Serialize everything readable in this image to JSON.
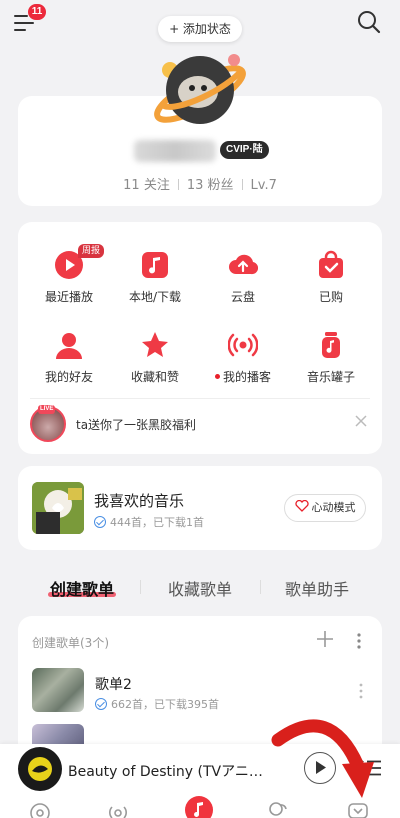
{
  "top": {
    "menu_badge": "11",
    "add_status": "+ 添加状态"
  },
  "profile": {
    "vip_badge": "CVIP·陆",
    "follows": "11 关注",
    "fans": "13 粉丝",
    "level": "Lv.7"
  },
  "grid": {
    "weekly_tag": "周报",
    "items": [
      {
        "label": "最近播放",
        "icon": "play-circle-icon"
      },
      {
        "label": "本地/下载",
        "icon": "music-note-icon"
      },
      {
        "label": "云盘",
        "icon": "cloud-upload-icon"
      },
      {
        "label": "已购",
        "icon": "shopping-bag-icon"
      },
      {
        "label": "我的好友",
        "icon": "person-icon"
      },
      {
        "label": "收藏和赞",
        "icon": "star-icon"
      },
      {
        "label": "我的播客",
        "icon": "podcast-icon"
      },
      {
        "label": "音乐罐子",
        "icon": "music-jar-icon"
      }
    ]
  },
  "gift": {
    "live_tag": "LIVE",
    "text": "ta送你了一张黑胶福利"
  },
  "liked": {
    "title": "我喜欢的音乐",
    "sub": "444首，已下载1首",
    "mode_button": "心动模式"
  },
  "tabs": [
    {
      "label": "创建歌单",
      "active": true
    },
    {
      "label": "收藏歌单",
      "active": false
    },
    {
      "label": "歌单助手",
      "active": false
    }
  ],
  "playlists": {
    "header": "创建歌单(3个)",
    "items": [
      {
        "title": "歌单2",
        "sub": "662首，已下载395首"
      }
    ]
  },
  "player": {
    "song": "Beauty of Destiny (TVアニ…"
  },
  "colors": {
    "accent": "#f0343e",
    "background": "#f2f2f4",
    "arrow": "#d9201c"
  }
}
